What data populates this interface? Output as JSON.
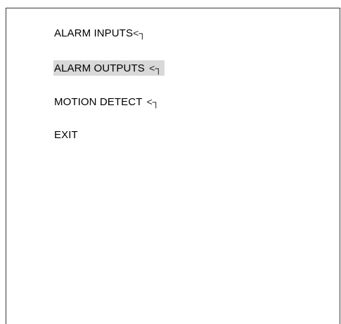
{
  "menu": {
    "items": [
      {
        "label": "ALARM INPUTS",
        "icon": "enter-icon",
        "icon_glyph": "<┐",
        "selected": false
      },
      {
        "label": "ALARM OUTPUTS",
        "icon": "enter-icon",
        "icon_glyph": "<┐",
        "selected": true
      },
      {
        "label": "MOTION DETECT",
        "icon": "enter-icon",
        "icon_glyph": "<┐",
        "selected": false
      },
      {
        "label": "EXIT",
        "selected": false
      }
    ],
    "highlight_color": "#d9d9d9"
  }
}
